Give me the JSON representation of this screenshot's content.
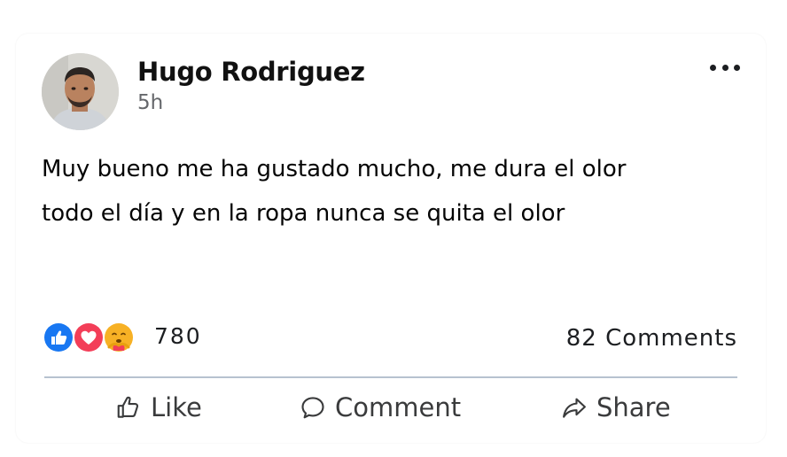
{
  "post": {
    "author": "Hugo Rodriguez",
    "time": "5h",
    "text_lines": [
      "Muy bueno me ha gustado mucho, me dura el olor",
      "todo el día y en la ropa nunca se quita el olor"
    ]
  },
  "reactions": {
    "icons": [
      "like-icon",
      "love-icon",
      "care-icon"
    ],
    "count": "780"
  },
  "comments": {
    "label": "82 Comments"
  },
  "actions": {
    "like": "Like",
    "comment": "Comment",
    "share": "Share"
  },
  "colors": {
    "like_blue": "#1877f2",
    "love_red": "#f33e58",
    "care_yellow": "#f7b125",
    "divider": "#b7c2cf"
  }
}
